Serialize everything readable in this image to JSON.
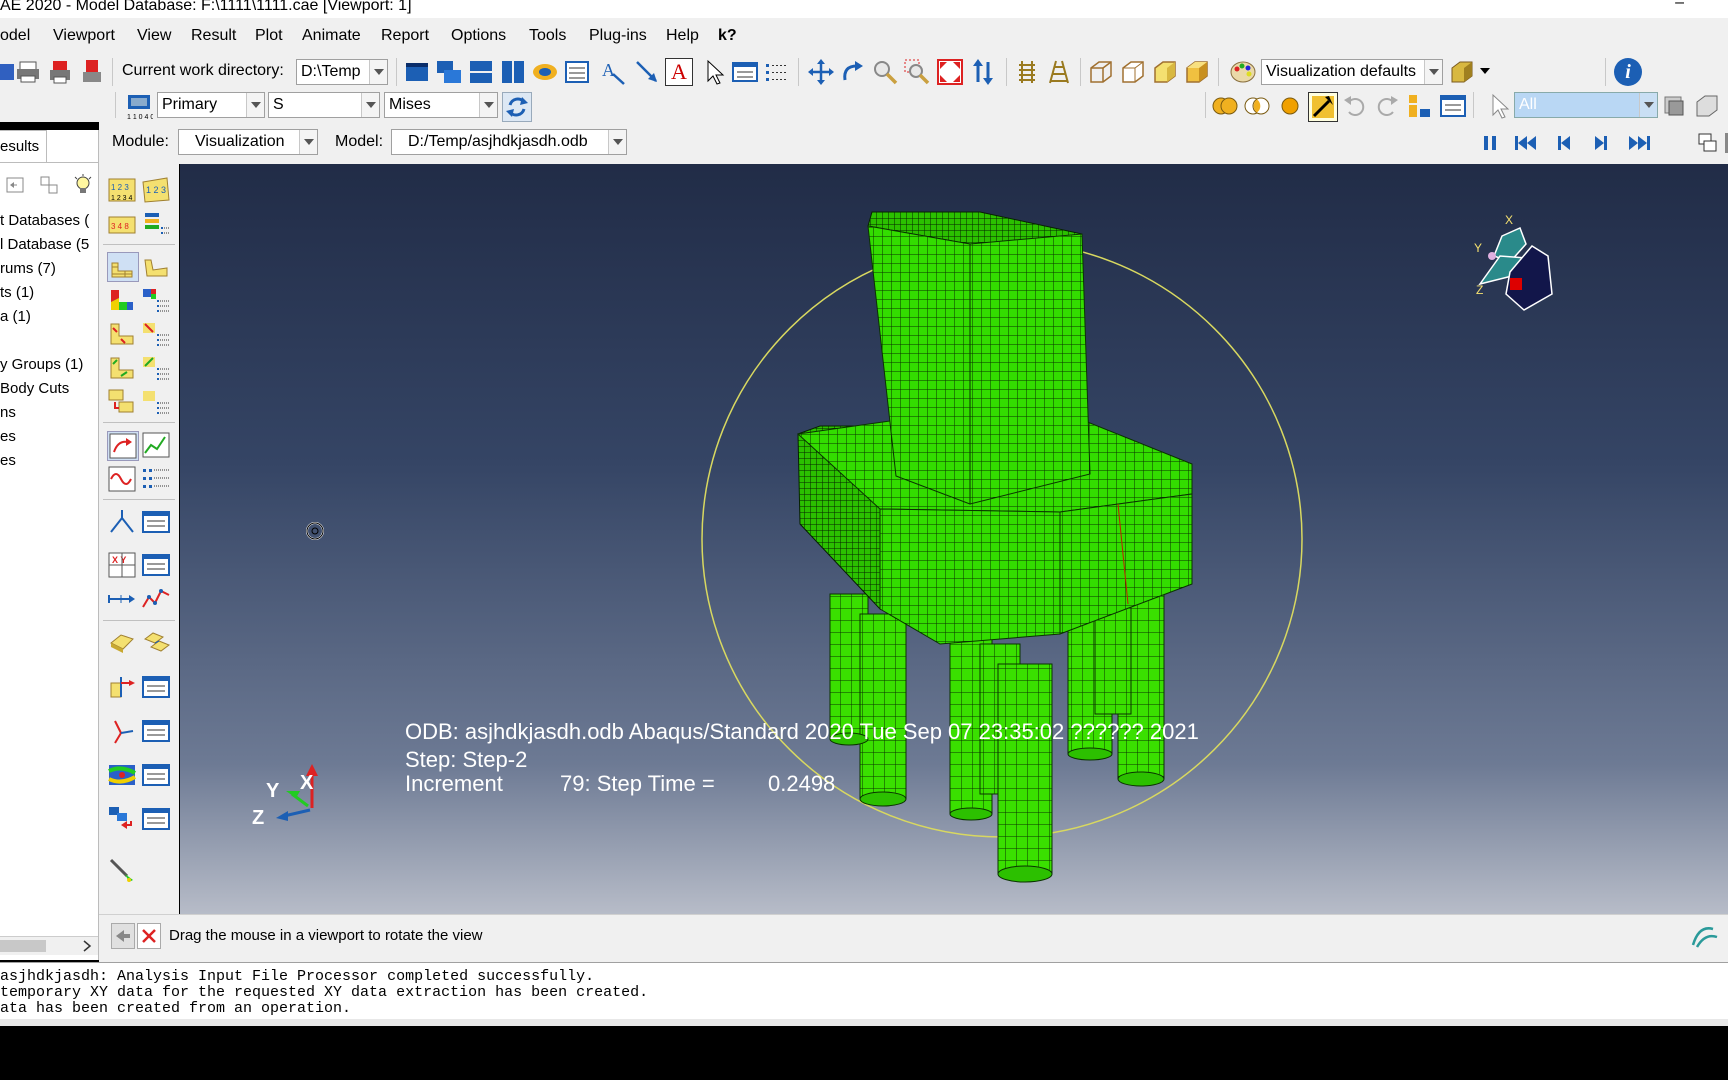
{
  "window": {
    "title": "AE 2020 - Model Database: F:\\1111\\1111.cae [Viewport: 1]",
    "minimize_glyph": "–"
  },
  "menubar": {
    "items": [
      {
        "label": "odel"
      },
      {
        "label": "Viewport"
      },
      {
        "label": "View"
      },
      {
        "label": "Result"
      },
      {
        "label": "Plot"
      },
      {
        "label": "Animate"
      },
      {
        "label": "Report"
      },
      {
        "label": "Options"
      },
      {
        "label": "Tools"
      },
      {
        "label": "Plug-ins"
      },
      {
        "label": "Help"
      },
      {
        "label": "k?"
      }
    ]
  },
  "toolbar": {
    "cwd_label": "Current work directory:",
    "cwd_value": "D:\\Temp",
    "visualization_defaults": "Visualization defaults",
    "info_glyph": "i",
    "text_tool_glyph": "A"
  },
  "toolbar2": {
    "primary": "Primary",
    "variable": "S",
    "invariant": "Mises",
    "selection_filter": "All"
  },
  "context_bar": {
    "module_label": "Module:",
    "module_value": "Visualization",
    "model_label": "Model:",
    "model_value": "D:/Temp/asjhdkjasdh.odb"
  },
  "tree": {
    "tab_label": "esults",
    "items": [
      "t Databases (",
      "l Database (5",
      "rums (7)",
      "ts (1)",
      "a (1)",
      "y Groups (1)",
      "Body Cuts",
      "ns",
      "es",
      "es"
    ]
  },
  "viewport": {
    "odb_line": "ODB: asjhdkjasdh.odb    Abaqus/Standard 2020    Tue Sep 07 23:35:02 ?????? 2021",
    "step_line": "Step: Step-2",
    "increment_label": "Increment",
    "increment_value": "79: Step Time =",
    "step_time": "0.2498",
    "triad": {
      "x": "X",
      "y": "Y",
      "z": "Z"
    },
    "view_cube": {
      "x": "X",
      "y": "Y",
      "z": "Z"
    },
    "mesh_color": "#33dd00",
    "circle_color": "#d8d860"
  },
  "prompt": {
    "text": "Drag the mouse in a viewport to rotate the view"
  },
  "messages": [
    "asjhdkjasdh: Analysis Input File Processor completed successfully.",
    "temporary XY data for the requested XY data extraction has been created.",
    "ata has been created from an operation."
  ]
}
